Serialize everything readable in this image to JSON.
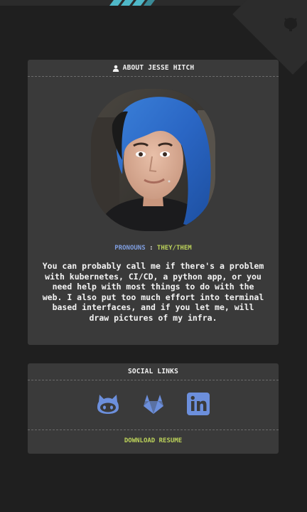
{
  "about": {
    "header": "ABOUT JESSE HITCH",
    "header_icon": "user-icon",
    "pronouns_label": "PRONOUNS",
    "pronouns_separator": ":",
    "pronouns_value": "THEY/THEM",
    "bio": "You can probably call me if there's a problem with kubernetes, CI/CD, a python app, or you need help with most things to do with the web. I also put too much effort into terminal based interfaces, and if you let me, will draw pictures of my infra."
  },
  "social": {
    "header": "SOCIAL LINKS",
    "links": [
      {
        "icon": "github-icon"
      },
      {
        "icon": "gitlab-icon"
      },
      {
        "icon": "linkedin-icon"
      }
    ],
    "resume_label": "DOWNLOAD RESUME"
  },
  "colors": {
    "background": "#1f1f1f",
    "card": "#3a3a3a",
    "accent_blue": "#7f9ee0",
    "accent_green": "#bcd25a",
    "icon_blue": "#6c8fdc",
    "top_accent": "#4fb8c8"
  }
}
